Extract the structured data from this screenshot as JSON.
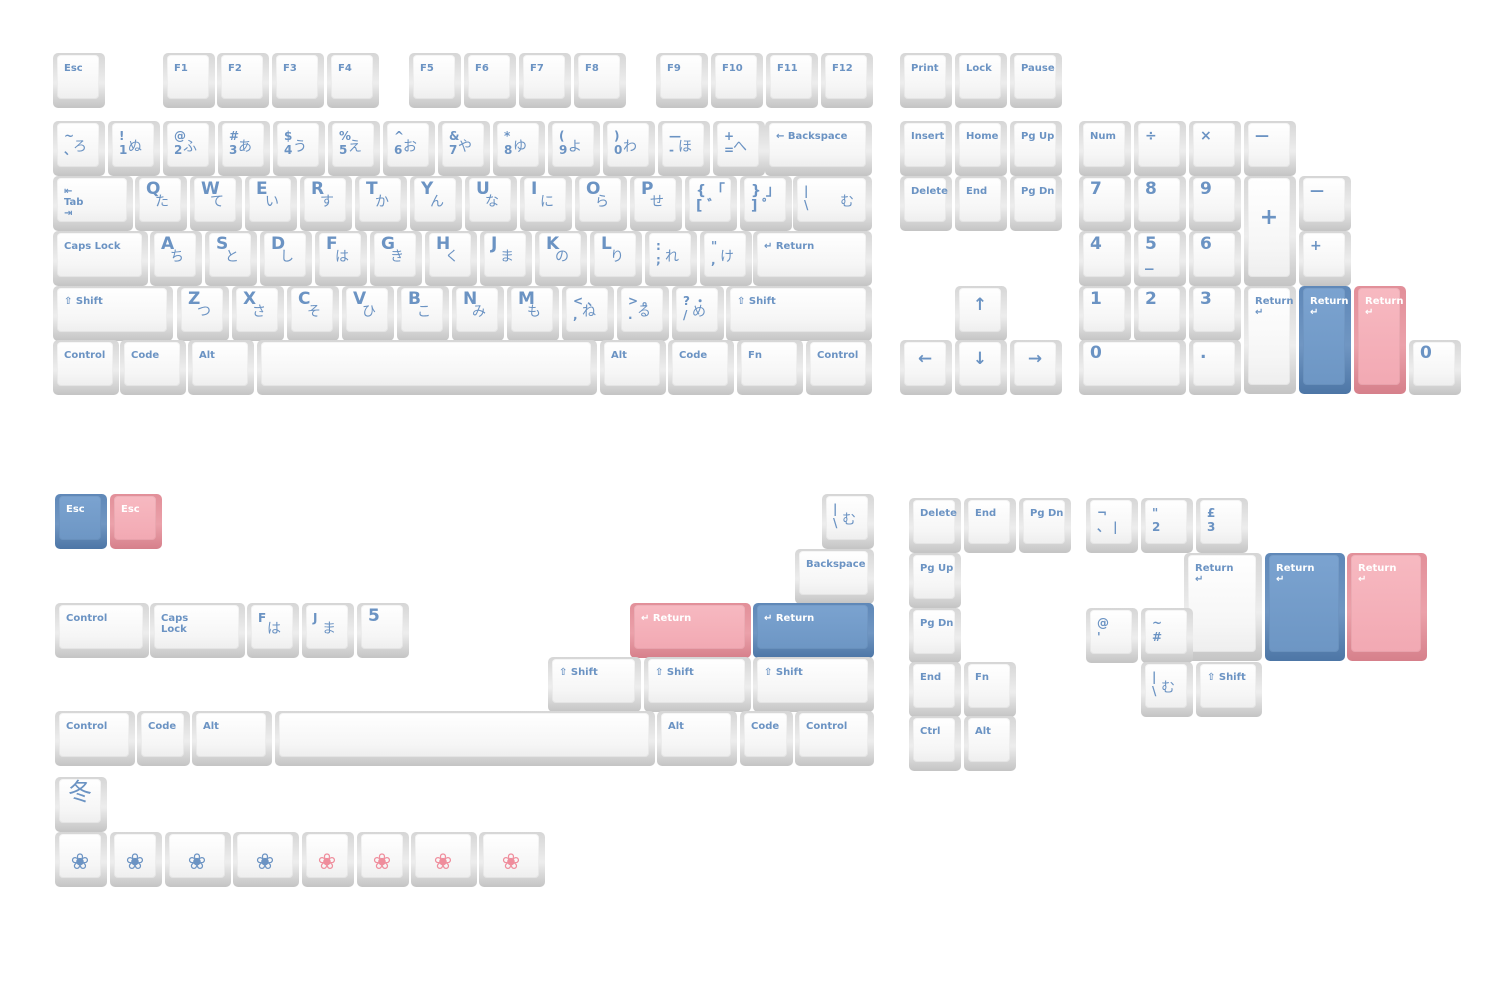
{
  "colors": {
    "legend_blue": "#6b93c3",
    "accent_blue": "#6d96c4",
    "accent_pink": "#f2a9b3",
    "keycap_white": "#f6f6f6"
  },
  "keys": [
    {
      "id": "esc",
      "label": "Esc"
    },
    {
      "id": "f1",
      "label": "F1"
    },
    {
      "id": "f2",
      "label": "F2"
    },
    {
      "id": "f3",
      "label": "F3"
    },
    {
      "id": "f4",
      "label": "F4"
    },
    {
      "id": "f5",
      "label": "F5"
    },
    {
      "id": "f6",
      "label": "F6"
    },
    {
      "id": "f7",
      "label": "F7"
    },
    {
      "id": "f8",
      "label": "F8"
    },
    {
      "id": "f9",
      "label": "F9"
    },
    {
      "id": "f10",
      "label": "F10"
    },
    {
      "id": "f11",
      "label": "F11"
    },
    {
      "id": "f12",
      "label": "F12"
    },
    {
      "id": "print",
      "label": "Print"
    },
    {
      "id": "lock",
      "label": "Lock"
    },
    {
      "id": "pause",
      "label": "Pause"
    },
    {
      "id": "grave",
      "label": "~\n、",
      "kana": "ろ"
    },
    {
      "id": "n1",
      "label": "!\n1",
      "kana": "ぬ"
    },
    {
      "id": "n2",
      "label": "@\n2",
      "kana": "ふ"
    },
    {
      "id": "n3",
      "label": "#\n3",
      "kana": "あ"
    },
    {
      "id": "n4",
      "label": "$\n4",
      "kana": "う"
    },
    {
      "id": "n5",
      "label": "%\n5",
      "kana": "え"
    },
    {
      "id": "n6",
      "label": "^\n6",
      "kana": "お"
    },
    {
      "id": "n7",
      "label": "&\n7",
      "kana": "や"
    },
    {
      "id": "n8",
      "label": "*\n8",
      "kana": "ゆ"
    },
    {
      "id": "n9",
      "label": "(\n9",
      "kana": "よ"
    },
    {
      "id": "n0",
      "label": ")\n0",
      "kana": "わ"
    },
    {
      "id": "minus",
      "label": "—\n-",
      "kana": "ほ"
    },
    {
      "id": "equal",
      "label": "+\n=",
      "kana": "へ"
    },
    {
      "id": "backspace",
      "label": "← Backspace"
    },
    {
      "id": "insert",
      "label": "Insert"
    },
    {
      "id": "home",
      "label": "Home"
    },
    {
      "id": "pgup",
      "label": "Pg Up"
    },
    {
      "id": "num",
      "label": "Num"
    },
    {
      "id": "kp_div",
      "label": "÷"
    },
    {
      "id": "kp_mul",
      "label": "×"
    },
    {
      "id": "kp_sub",
      "label": "—"
    },
    {
      "id": "tab",
      "label": "⇤\nTab\n⇥"
    },
    {
      "id": "q",
      "label": "Q",
      "kana": "た"
    },
    {
      "id": "w",
      "label": "W",
      "kana": "て"
    },
    {
      "id": "e",
      "label": "E",
      "kana": "い"
    },
    {
      "id": "r",
      "label": "R",
      "kana": "す"
    },
    {
      "id": "t",
      "label": "T",
      "kana": "か"
    },
    {
      "id": "y",
      "label": "Y",
      "kana": "ん"
    },
    {
      "id": "u",
      "label": "U",
      "kana": "な"
    },
    {
      "id": "i",
      "label": "I",
      "kana": "に"
    },
    {
      "id": "o",
      "label": "O",
      "kana": "ら"
    },
    {
      "id": "p",
      "label": "P",
      "kana": "せ"
    },
    {
      "id": "lbracket",
      "label": "{ 「\n[ ゛"
    },
    {
      "id": "rbracket",
      "label": "} 」\n] ゜"
    },
    {
      "id": "backslash",
      "label": "|\n\\",
      "kana": "む"
    },
    {
      "id": "delete",
      "label": "Delete"
    },
    {
      "id": "end",
      "label": "End"
    },
    {
      "id": "pgdn",
      "label": "Pg Dn"
    },
    {
      "id": "kp7",
      "label": "7"
    },
    {
      "id": "kp8",
      "label": "8"
    },
    {
      "id": "kp9",
      "label": "9"
    },
    {
      "id": "kp_plus_tall",
      "label": "+"
    },
    {
      "id": "kp_minus2",
      "label": "—"
    },
    {
      "id": "capslock",
      "label": "Caps Lock"
    },
    {
      "id": "a",
      "label": "A",
      "kana": "ち"
    },
    {
      "id": "s",
      "label": "S",
      "kana": "と"
    },
    {
      "id": "d",
      "label": "D",
      "kana": "し"
    },
    {
      "id": "f",
      "label": "F",
      "kana": "は"
    },
    {
      "id": "g",
      "label": "G",
      "kana": "き"
    },
    {
      "id": "h",
      "label": "H",
      "kana": "く"
    },
    {
      "id": "j",
      "label": "J",
      "kana": "ま"
    },
    {
      "id": "k",
      "label": "K",
      "kana": "の"
    },
    {
      "id": "l",
      "label": "L",
      "kana": "り"
    },
    {
      "id": "semicolon",
      "label": ":\n;",
      "kana": "れ"
    },
    {
      "id": "quote",
      "label": "\"\n,",
      "kana": "け"
    },
    {
      "id": "return",
      "label": "↵ Return"
    },
    {
      "id": "kp4",
      "label": "4"
    },
    {
      "id": "kp5",
      "label": "5\n_"
    },
    {
      "id": "kp6",
      "label": "6"
    },
    {
      "id": "kp_plus",
      "label": "+"
    },
    {
      "id": "lshift",
      "label": "⇧ Shift"
    },
    {
      "id": "z",
      "label": "Z",
      "kana": "つ"
    },
    {
      "id": "x",
      "label": "X",
      "kana": "さ"
    },
    {
      "id": "c",
      "label": "C",
      "kana": "そ"
    },
    {
      "id": "v",
      "label": "V",
      "kana": "ひ"
    },
    {
      "id": "b",
      "label": "B",
      "kana": "こ"
    },
    {
      "id": "n",
      "label": "N",
      "kana": "み"
    },
    {
      "id": "m",
      "label": "M",
      "kana": "も"
    },
    {
      "id": "comma",
      "label": "< 、\n,",
      "kana": "ね"
    },
    {
      "id": "period",
      "label": "> 。\n.",
      "kana": "る"
    },
    {
      "id": "slash",
      "label": "? ・\n/",
      "kana": "め"
    },
    {
      "id": "rshift",
      "label": "⇧ Shift"
    },
    {
      "id": "up",
      "label": "↑"
    },
    {
      "id": "kp1",
      "label": "1"
    },
    {
      "id": "kp2",
      "label": "2"
    },
    {
      "id": "kp3",
      "label": "3"
    },
    {
      "id": "kp_return",
      "label": "Return\n↵"
    },
    {
      "id": "kp_return_blue",
      "label": "Return\n↵"
    },
    {
      "id": "kp_return_pink",
      "label": "Return\n↵"
    },
    {
      "id": "lctrl",
      "label": "Control"
    },
    {
      "id": "lcode",
      "label": "Code"
    },
    {
      "id": "lalt",
      "label": "Alt"
    },
    {
      "id": "space",
      "label": ""
    },
    {
      "id": "ralt",
      "label": "Alt"
    },
    {
      "id": "rcode",
      "label": "Code"
    },
    {
      "id": "fn",
      "label": "Fn"
    },
    {
      "id": "rctrl",
      "label": "Control"
    },
    {
      "id": "left",
      "label": "←"
    },
    {
      "id": "down",
      "label": "↓"
    },
    {
      "id": "right",
      "label": "→"
    },
    {
      "id": "kp0",
      "label": "0"
    },
    {
      "id": "kp_dot",
      "label": "."
    },
    {
      "id": "kp0_alt",
      "label": "0"
    },
    {
      "id": "esc_blue",
      "label": "Esc"
    },
    {
      "id": "esc_pink",
      "label": "Esc"
    },
    {
      "id": "ext_backslash",
      "label": "|\n\\",
      "kana": "む"
    },
    {
      "id": "ext_backspace",
      "label": "Backspace"
    },
    {
      "id": "ext_control",
      "label": "Control"
    },
    {
      "id": "ext_caps",
      "label": "Caps\nLock"
    },
    {
      "id": "ext_f",
      "label": "F",
      "kana": "は"
    },
    {
      "id": "ext_j",
      "label": "J",
      "kana": "ま"
    },
    {
      "id": "ext_5",
      "label": "5"
    },
    {
      "id": "ext_return_pink",
      "label": "↵ Return"
    },
    {
      "id": "ext_return_blue",
      "label": "↵ Return"
    },
    {
      "id": "ext_shift1",
      "label": "⇧ Shift"
    },
    {
      "id": "ext_shift2",
      "label": "⇧ Shift"
    },
    {
      "id": "ext_shift3",
      "label": "⇧ Shift"
    },
    {
      "id": "ext_ctrl1",
      "label": "Control"
    },
    {
      "id": "ext_code1",
      "label": "Code"
    },
    {
      "id": "ext_alt1",
      "label": "Alt"
    },
    {
      "id": "ext_space",
      "label": ""
    },
    {
      "id": "ext_alt2",
      "label": "Alt"
    },
    {
      "id": "ext_code2",
      "label": "Code"
    },
    {
      "id": "ext_ctrl2",
      "label": "Control"
    },
    {
      "id": "kanji_winter",
      "label": "冬"
    },
    {
      "id": "sakura1",
      "label": "❀"
    },
    {
      "id": "sakura2",
      "label": "❀"
    },
    {
      "id": "sakura3",
      "label": "❀"
    },
    {
      "id": "sakura4",
      "label": "❀"
    },
    {
      "id": "sakura5",
      "label": "❀"
    },
    {
      "id": "sakura6",
      "label": "❀"
    },
    {
      "id": "sakura7",
      "label": "❀"
    },
    {
      "id": "sakura8",
      "label": "❀"
    },
    {
      "id": "nav_delete",
      "label": "Delete"
    },
    {
      "id": "nav_end",
      "label": "End"
    },
    {
      "id": "nav_pgdn",
      "label": "Pg Dn"
    },
    {
      "id": "nav_pgup",
      "label": "Pg Up"
    },
    {
      "id": "nav_pgdn2",
      "label": "Pg Dn"
    },
    {
      "id": "nav_end2",
      "label": "End"
    },
    {
      "id": "nav_fn",
      "label": "Fn"
    },
    {
      "id": "nav_ctrl",
      "label": "Ctrl"
    },
    {
      "id": "nav_alt",
      "label": "Alt"
    },
    {
      "id": "iso_grave",
      "label": "¬\n、 |"
    },
    {
      "id": "iso_2",
      "label": "\"\n2"
    },
    {
      "id": "iso_3",
      "label": "£\n3"
    },
    {
      "id": "iso_return",
      "label": "Return\n↵"
    },
    {
      "id": "iso_return_blue",
      "label": "Return\n↵"
    },
    {
      "id": "iso_return_pink",
      "label": "Return\n↵"
    },
    {
      "id": "iso_at",
      "label": "@\n'"
    },
    {
      "id": "iso_hash",
      "label": "~\n#"
    },
    {
      "id": "iso_backslash",
      "label": "|\n\\",
      "kana": "む"
    },
    {
      "id": "iso_shift",
      "label": "⇧ Shift"
    }
  ]
}
